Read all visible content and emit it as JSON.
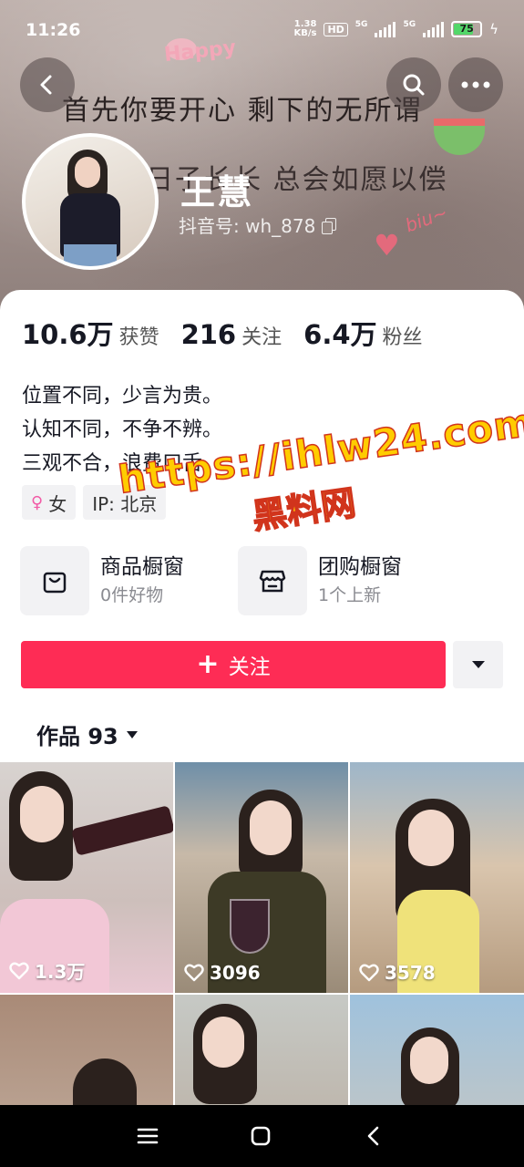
{
  "status_bar": {
    "time": "11:26",
    "net_speed_value": "1.38",
    "net_speed_unit": "KB/s",
    "hd_label": "HD",
    "sim1_label": "5G",
    "sim2_label": "5G",
    "battery_percent": 75,
    "battery_label": "75"
  },
  "cover": {
    "line1": "首先你要开心  剩下的无所谓",
    "line2": "日子长长  总会如愿以偿",
    "sticker_happy": "Happy",
    "sticker_biu": "biu~"
  },
  "profile": {
    "name": "王慧",
    "douyin_id": "抖音号: wh_878"
  },
  "stats": [
    {
      "num": "10.6万",
      "label": "获赞"
    },
    {
      "num": "216",
      "label": "关注"
    },
    {
      "num": "6.4万",
      "label": "粉丝"
    }
  ],
  "bio": [
    "位置不同，少言为贵。",
    "认知不同，不争不辨。",
    "三观不合，浪费口舌。"
  ],
  "tags": {
    "gender": "女",
    "ip": "IP: 北京"
  },
  "shop": {
    "goods_title": "商品橱窗",
    "goods_sub": "0件好物",
    "group_title": "团购橱窗",
    "group_sub": "1个上新"
  },
  "follow": {
    "plus": "+",
    "label": "关注"
  },
  "works": {
    "label": "作品 93"
  },
  "videos": [
    {
      "likes": "1.3万"
    },
    {
      "likes": "3096"
    },
    {
      "likes": "3578"
    },
    {
      "likes": ""
    },
    {
      "likes": ""
    },
    {
      "likes": ""
    }
  ],
  "watermark": {
    "url": "https://ihlw24.com",
    "label": "黑料网"
  },
  "colors": {
    "accent": "#fe2c55",
    "watermark_fill": "#ffcc00",
    "watermark_stroke": "#d1341c"
  }
}
